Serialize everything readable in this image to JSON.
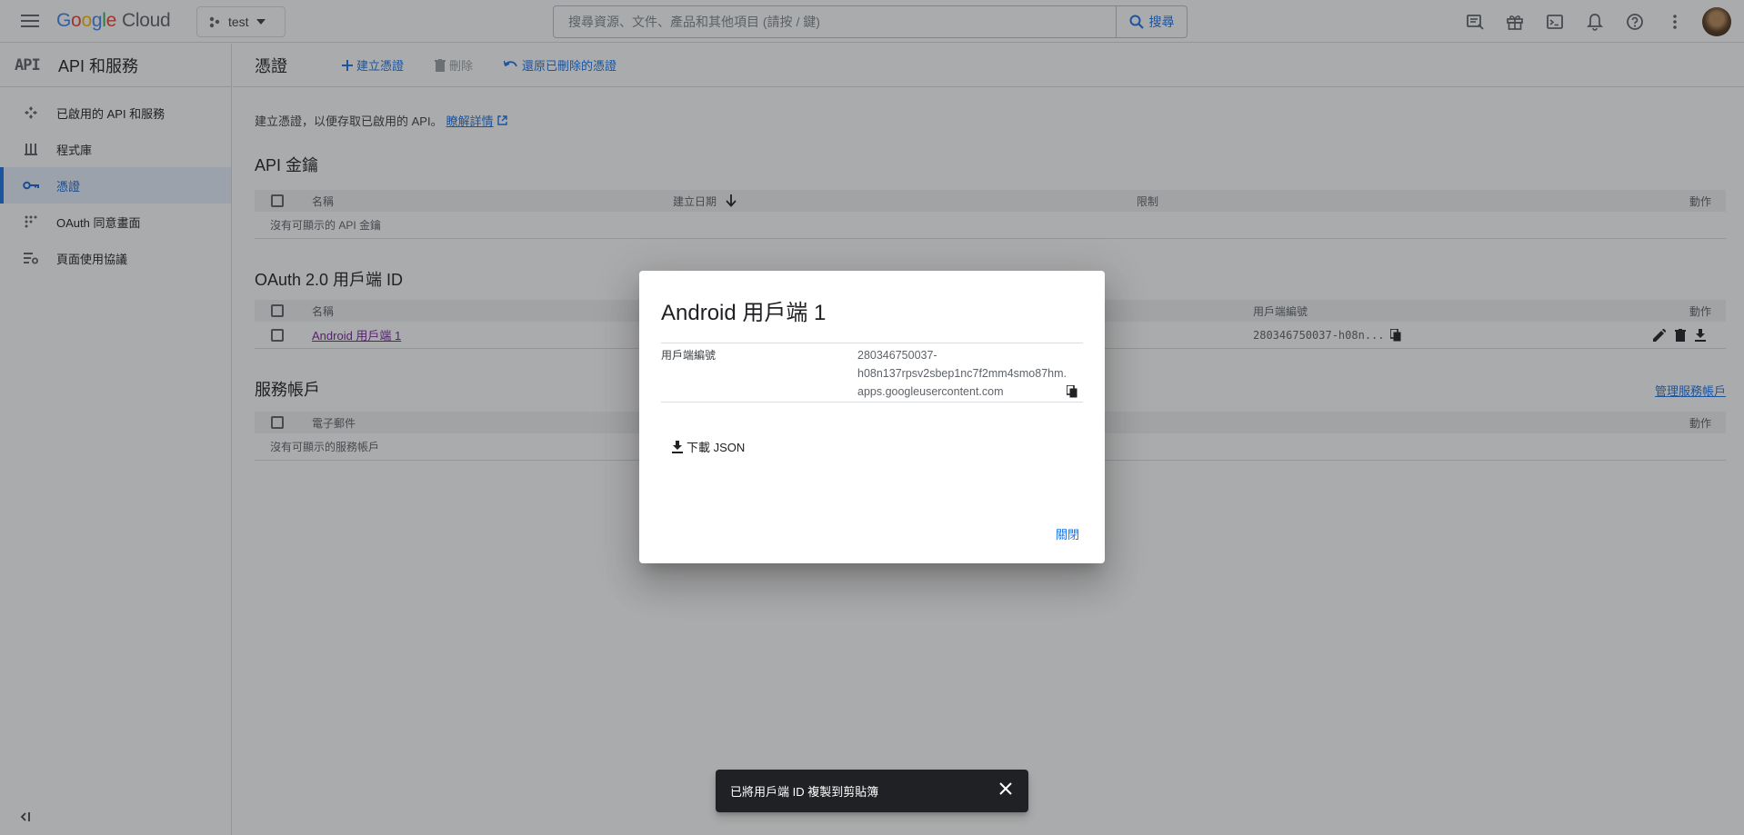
{
  "topbar": {
    "logo_letters": [
      "G",
      "o",
      "o",
      "g",
      "l",
      "e"
    ],
    "logo_suffix": "Cloud",
    "project": "test",
    "search_placeholder": "搜尋資源、文件、產品和其他項目 (請按 / 鍵)",
    "search_button": "搜尋",
    "icons": [
      "notes-icon",
      "gift-icon",
      "terminal-icon",
      "bell-icon",
      "help-icon",
      "more-vert-icon",
      "avatar"
    ]
  },
  "sidebar": {
    "mark": "API",
    "title": "API 和服務",
    "items": [
      {
        "label": "已啟用的 API 和服務",
        "icon": "apis-icon",
        "active": false
      },
      {
        "label": "程式庫",
        "icon": "library-icon",
        "active": false
      },
      {
        "label": "憑證",
        "icon": "key-icon",
        "active": true
      },
      {
        "label": "OAuth 同意畫面",
        "icon": "consent-icon",
        "active": false
      },
      {
        "label": "頁面使用協議",
        "icon": "settings-list-icon",
        "active": false
      }
    ],
    "collapse_glyph": "<|"
  },
  "main": {
    "title": "憑證",
    "actions": {
      "create": "建立憑證",
      "delete": "刪除",
      "restore": "還原已刪除的憑證"
    },
    "intro_text": "建立憑證，以便存取已啟用的 API。",
    "intro_link": "瞭解詳情",
    "api_keys": {
      "title": "API 金鑰",
      "headers": {
        "name": "名稱",
        "created": "建立日期",
        "restriction": "限制",
        "actions": "動作"
      },
      "empty": "沒有可顯示的 API 金鑰"
    },
    "oauth": {
      "title": "OAuth 2.0 用戶端 ID",
      "headers": {
        "name": "名稱",
        "client_id": "用戶端編號",
        "actions": "動作"
      },
      "rows": [
        {
          "name": "Android 用戶端 1",
          "client_id": "280346750037-h08n..."
        }
      ]
    },
    "service_accounts": {
      "title": "服務帳戶",
      "manage_link": "管理服務帳戶",
      "headers": {
        "email": "電子郵件",
        "actions": "動作"
      },
      "empty": "沒有可顯示的服務帳戶"
    }
  },
  "dialog": {
    "title": "Android 用戶端 1",
    "label": "用戶端編號",
    "value_line1": "280346750037-",
    "value_line2": "h08n137rpsv2sbep1nc7f2mm4smo87hm.",
    "value_line3": "apps.googleusercontent.com",
    "download": "下載 JSON",
    "close": "關閉"
  },
  "snackbar": {
    "message": "已將用戶端 ID 複製到剪貼簿"
  },
  "colors": {
    "accent": "#1a73e8",
    "scrim": "rgba(32,33,36,0.38)",
    "snackbar_bg": "#202124"
  }
}
